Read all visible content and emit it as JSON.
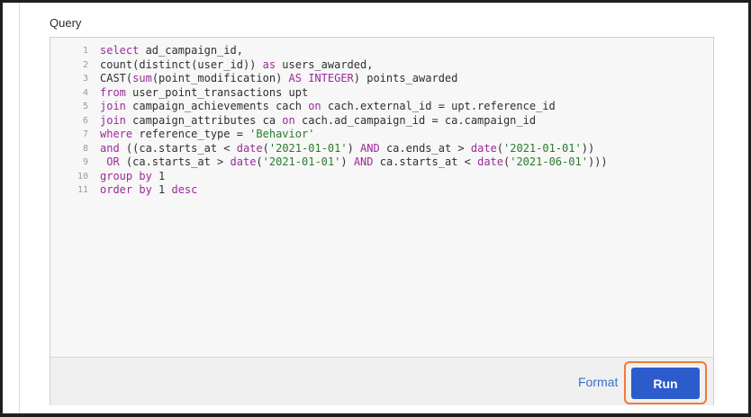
{
  "query_label": "Query",
  "editor": {
    "line_numbers": [
      "1",
      "2",
      "3",
      "4",
      "5",
      "6",
      "7",
      "8",
      "9",
      "10",
      "11"
    ],
    "lines": [
      [
        {
          "t": "select",
          "k": "kw"
        },
        {
          "t": " ad_campaign_id,",
          "k": ""
        }
      ],
      [
        {
          "t": "count(distinct(user_id)) ",
          "k": ""
        },
        {
          "t": "as",
          "k": "kw"
        },
        {
          "t": " users_awarded,",
          "k": ""
        }
      ],
      [
        {
          "t": "CAST(",
          "k": ""
        },
        {
          "t": "sum",
          "k": "kw"
        },
        {
          "t": "(point_modification) ",
          "k": ""
        },
        {
          "t": "AS INTEGER",
          "k": "kw"
        },
        {
          "t": ") points_awarded",
          "k": ""
        }
      ],
      [
        {
          "t": "from",
          "k": "kw"
        },
        {
          "t": " user_point_transactions upt",
          "k": ""
        }
      ],
      [
        {
          "t": "join",
          "k": "kw"
        },
        {
          "t": " campaign_achievements cach ",
          "k": ""
        },
        {
          "t": "on",
          "k": "kw"
        },
        {
          "t": " cach.external_id = upt.reference_id",
          "k": ""
        }
      ],
      [
        {
          "t": "join",
          "k": "kw"
        },
        {
          "t": " campaign_attributes ca ",
          "k": ""
        },
        {
          "t": "on",
          "k": "kw"
        },
        {
          "t": " cach.ad_campaign_id = ca.campaign_id",
          "k": ""
        }
      ],
      [
        {
          "t": "where",
          "k": "kw"
        },
        {
          "t": " reference_type = ",
          "k": ""
        },
        {
          "t": "'Behavior'",
          "k": "str"
        }
      ],
      [
        {
          "t": "and",
          "k": "kw"
        },
        {
          "t": " ((ca.starts_at < ",
          "k": ""
        },
        {
          "t": "date",
          "k": "kw"
        },
        {
          "t": "(",
          "k": ""
        },
        {
          "t": "'2021-01-01'",
          "k": "str"
        },
        {
          "t": ") ",
          "k": ""
        },
        {
          "t": "AND",
          "k": "kw"
        },
        {
          "t": " ca.ends_at > ",
          "k": ""
        },
        {
          "t": "date",
          "k": "kw"
        },
        {
          "t": "(",
          "k": ""
        },
        {
          "t": "'2021-01-01'",
          "k": "str"
        },
        {
          "t": "))",
          "k": ""
        }
      ],
      [
        {
          "t": " ",
          "k": ""
        },
        {
          "t": "OR",
          "k": "kw"
        },
        {
          "t": " (ca.starts_at > ",
          "k": ""
        },
        {
          "t": "date",
          "k": "kw"
        },
        {
          "t": "(",
          "k": ""
        },
        {
          "t": "'2021-01-01'",
          "k": "str"
        },
        {
          "t": ") ",
          "k": ""
        },
        {
          "t": "AND",
          "k": "kw"
        },
        {
          "t": " ca.starts_at < ",
          "k": ""
        },
        {
          "t": "date",
          "k": "kw"
        },
        {
          "t": "(",
          "k": ""
        },
        {
          "t": "'2021-06-01'",
          "k": "str"
        },
        {
          "t": ")))",
          "k": ""
        }
      ],
      [
        {
          "t": "group by",
          "k": "kw"
        },
        {
          "t": " 1",
          "k": ""
        }
      ],
      [
        {
          "t": "order by",
          "k": "kw"
        },
        {
          "t": " 1 ",
          "k": ""
        },
        {
          "t": "desc",
          "k": "kw"
        }
      ]
    ]
  },
  "toolbar": {
    "format_label": "Format",
    "run_label": "Run"
  },
  "colors": {
    "keyword": "#9b2a9b",
    "string": "#2a7a2a",
    "run_button": "#2c5ccc",
    "highlight_outline": "#f07a3a",
    "format_link": "#3a6fd0"
  }
}
